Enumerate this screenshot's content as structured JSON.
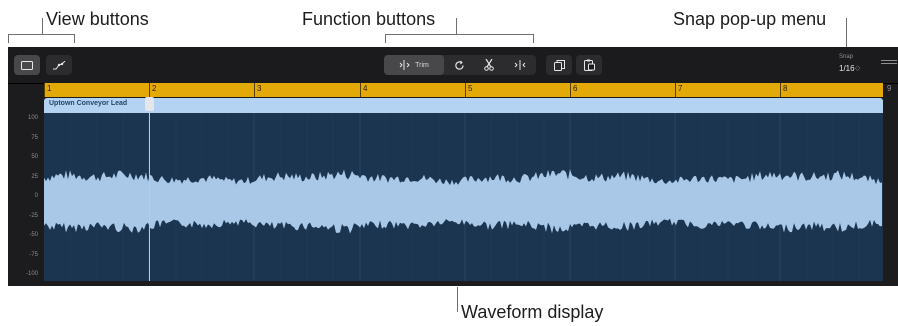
{
  "callouts": {
    "view_buttons": "View buttons",
    "function_buttons": "Function buttons",
    "snap_menu": "Snap pop-up menu",
    "waveform_display": "Waveform display"
  },
  "toolbar": {
    "view_buttons": [
      {
        "icon": "region-view-icon",
        "selected": true
      },
      {
        "icon": "automation-view-icon",
        "selected": false
      }
    ],
    "function_buttons": [
      {
        "icon": "trim-icon",
        "label": "Trim",
        "selected": true
      },
      {
        "icon": "loop-icon",
        "label": ""
      },
      {
        "icon": "scissors-icon",
        "label": ""
      },
      {
        "icon": "join-icon",
        "label": ""
      }
    ],
    "edit_buttons": [
      {
        "icon": "copy-icon"
      },
      {
        "icon": "paste-icon"
      }
    ],
    "snap": {
      "label": "Snap",
      "value": "1/16",
      "arrow": "◇"
    }
  },
  "ruler": {
    "bars": [
      "1",
      "2",
      "3",
      "4",
      "5",
      "6",
      "7",
      "8"
    ],
    "next_bar": "9",
    "color": "#e2a908"
  },
  "region": {
    "name": "Uptown Conveyor Lead",
    "header_color": "#b4d3f2",
    "wave_color": "#a9c8e8",
    "background": "#1b3550"
  },
  "y_axis": {
    "ticks": [
      "100",
      "75",
      "50",
      "25",
      "0",
      "-25",
      "-50",
      "-75",
      "-100"
    ]
  },
  "playhead": {
    "bar_position": 2.0
  }
}
